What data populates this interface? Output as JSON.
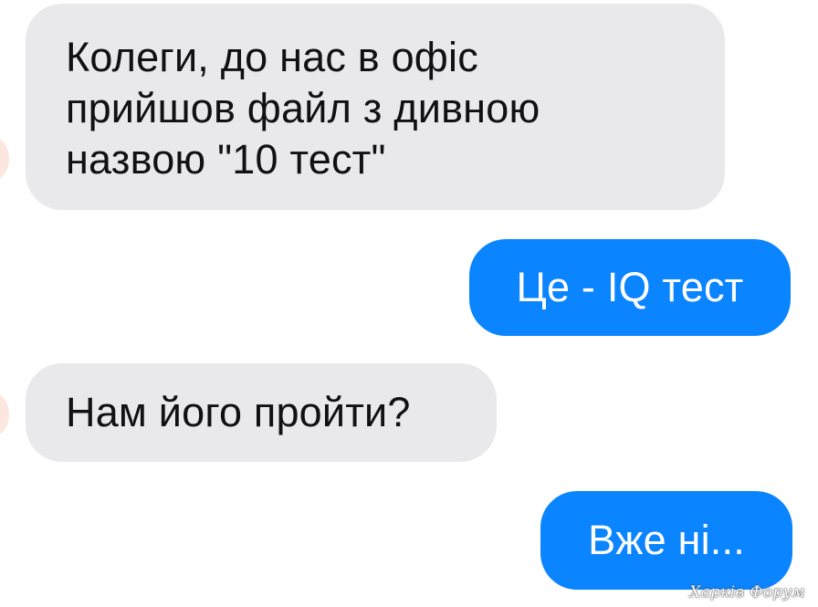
{
  "conversation": {
    "messages": [
      {
        "direction": "incoming",
        "text": "Колеги, до нас в офіс\nприйшов файл з дивною\nназвою \"10 тест\""
      },
      {
        "direction": "outgoing",
        "text": "Це - IQ тест"
      },
      {
        "direction": "incoming",
        "text": "Нам його пройти?"
      },
      {
        "direction": "outgoing",
        "text": "Вже ні..."
      }
    ]
  },
  "watermark": "Харків Форум",
  "colors": {
    "incoming_bubble": "#e9e9eb",
    "outgoing_bubble": "#0a84ff",
    "incoming_text": "#111111",
    "outgoing_text": "#ffffff",
    "background": "#ffffff"
  }
}
